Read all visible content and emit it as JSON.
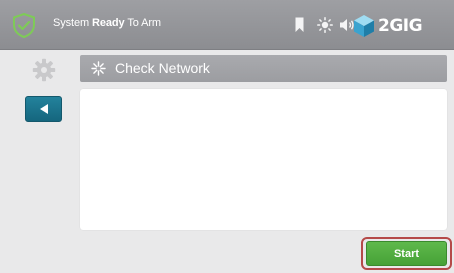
{
  "status_bar": {
    "status_prefix": "System",
    "status_emphasis": "Ready",
    "status_suffix": "To Arm",
    "brand": "2GIG",
    "icons": [
      "bookmark-icon",
      "brightness-icon",
      "volume-icon",
      "wifi-signal-icon",
      "cube-icon"
    ],
    "colors": {
      "bar": "#9a9b9f",
      "shield": "#7ecb57"
    }
  },
  "sidebar": {
    "icons": [
      "gear-icon",
      "back-arrow-icon"
    ],
    "back_color": "#1c7893"
  },
  "header": {
    "title": "Check Network",
    "icon": "snowflake-icon"
  },
  "footer": {
    "start_label": "Start",
    "start_color": "#52ad40",
    "highlight_color": "#b54a49"
  }
}
